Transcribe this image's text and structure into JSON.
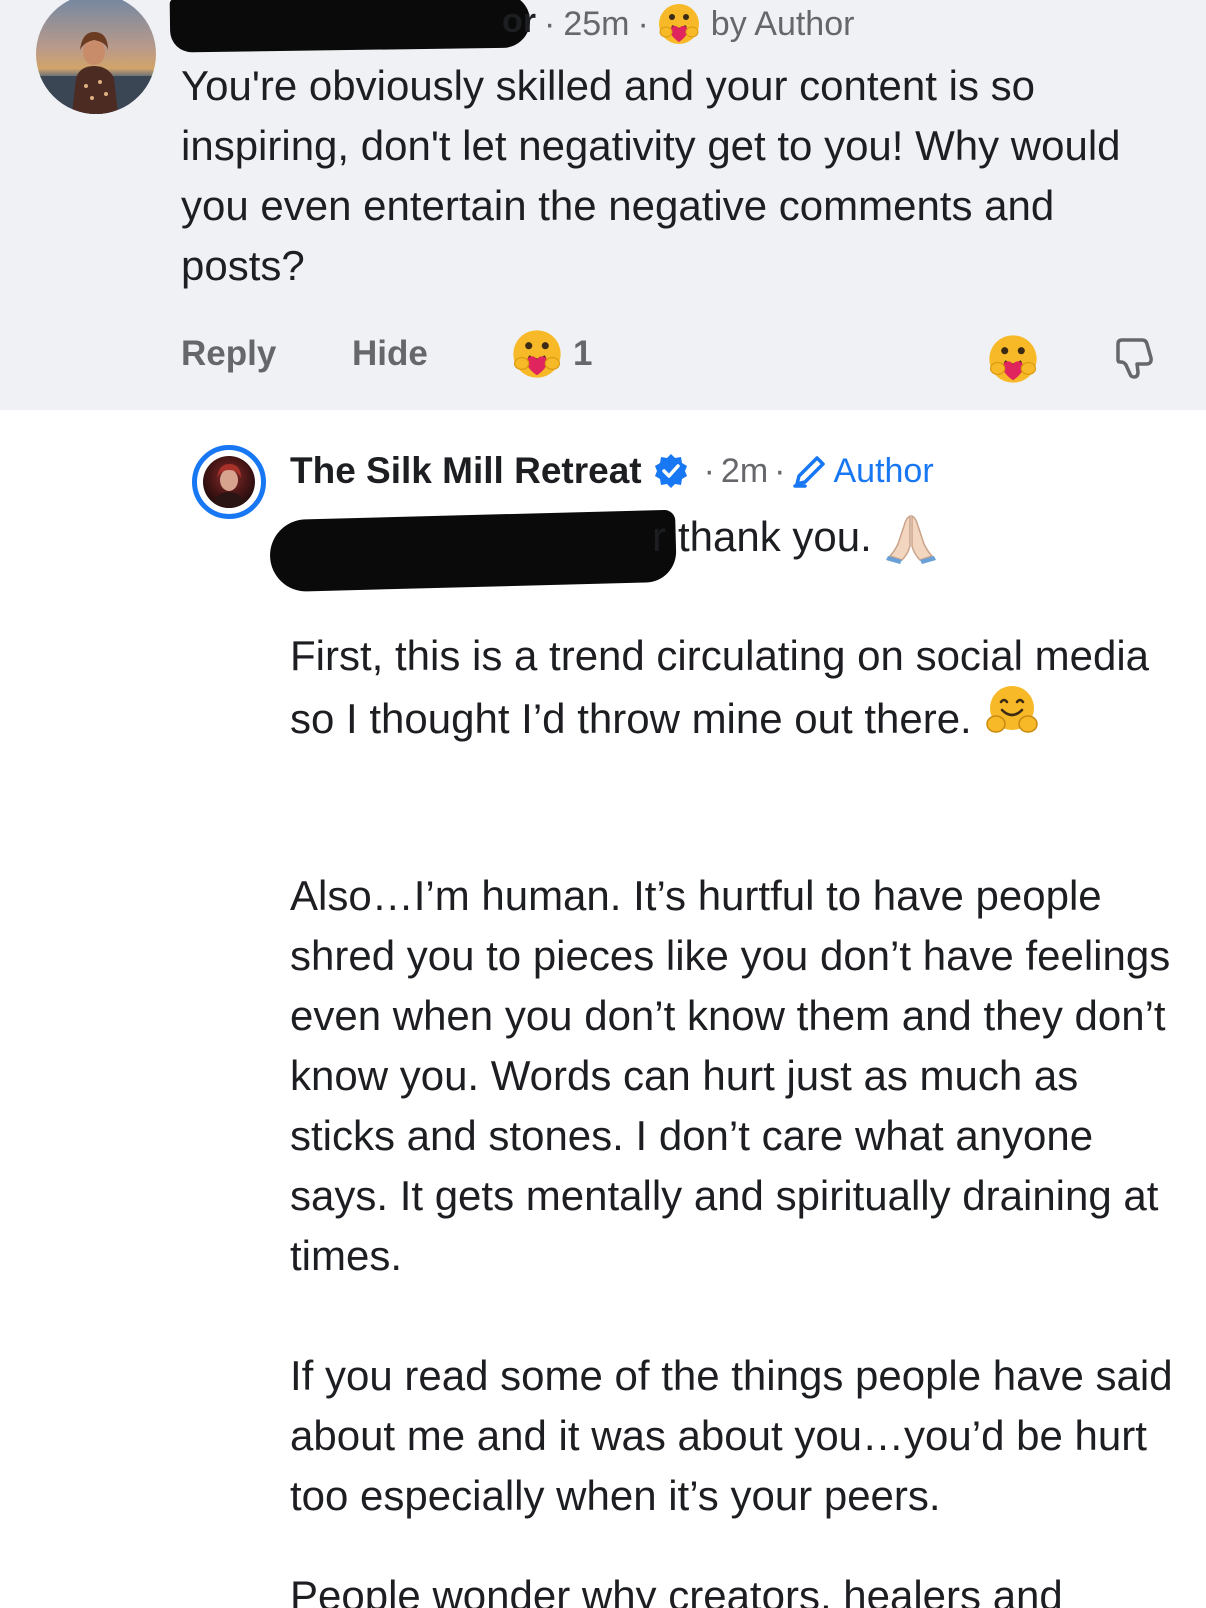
{
  "comment": {
    "name_visible_suffix": "or",
    "time": "25m",
    "separator": "·",
    "badge": "by Author",
    "text": "You're obviously skilled and your content is so inspiring, don't let negativity get to you! Why would you even entertain the negative comments and posts?",
    "actions": {
      "reply": "Reply",
      "hide": "Hide",
      "reaction_count": "1"
    },
    "icons": {
      "author_reaction": "care-emoji-icon",
      "reaction": "care-emoji-icon",
      "react_button": "care-emoji-icon",
      "dislike": "thumbs-down-icon"
    }
  },
  "reply": {
    "name": "The Silk Mill Retreat",
    "time": "2m",
    "separator": "·",
    "badge": "Author",
    "mention_visible_suffix": "r",
    "first_line": "thank you.",
    "paragraphs": [
      "First, this is a trend circulating on social media so I thought I’d throw mine out there.",
      "Also…I’m human. It’s hurtful to have people shred you to pieces like you don’t have feelings even when you don’t know them and they don’t know you. Words can hurt just as much as sticks and stones. I don’t care what anyone says. It gets mentally and spiritually draining at times.",
      "If you read some of the things people have said about me and it was about you…you’d be hurt too especially when it’s your peers.",
      "People wonder why creators, healers and"
    ],
    "icons": {
      "verified": "verified-badge-icon",
      "author": "pencil-icon",
      "first_line_emoji": "folded-hands-emoji-icon",
      "paragraph_emoji": "hugging-face-emoji-icon"
    }
  },
  "colors": {
    "comment_background": "#f0f1f4",
    "secondary_text": "#65676b",
    "link_blue": "#1877f2",
    "primary_text": "#1c1e21"
  }
}
